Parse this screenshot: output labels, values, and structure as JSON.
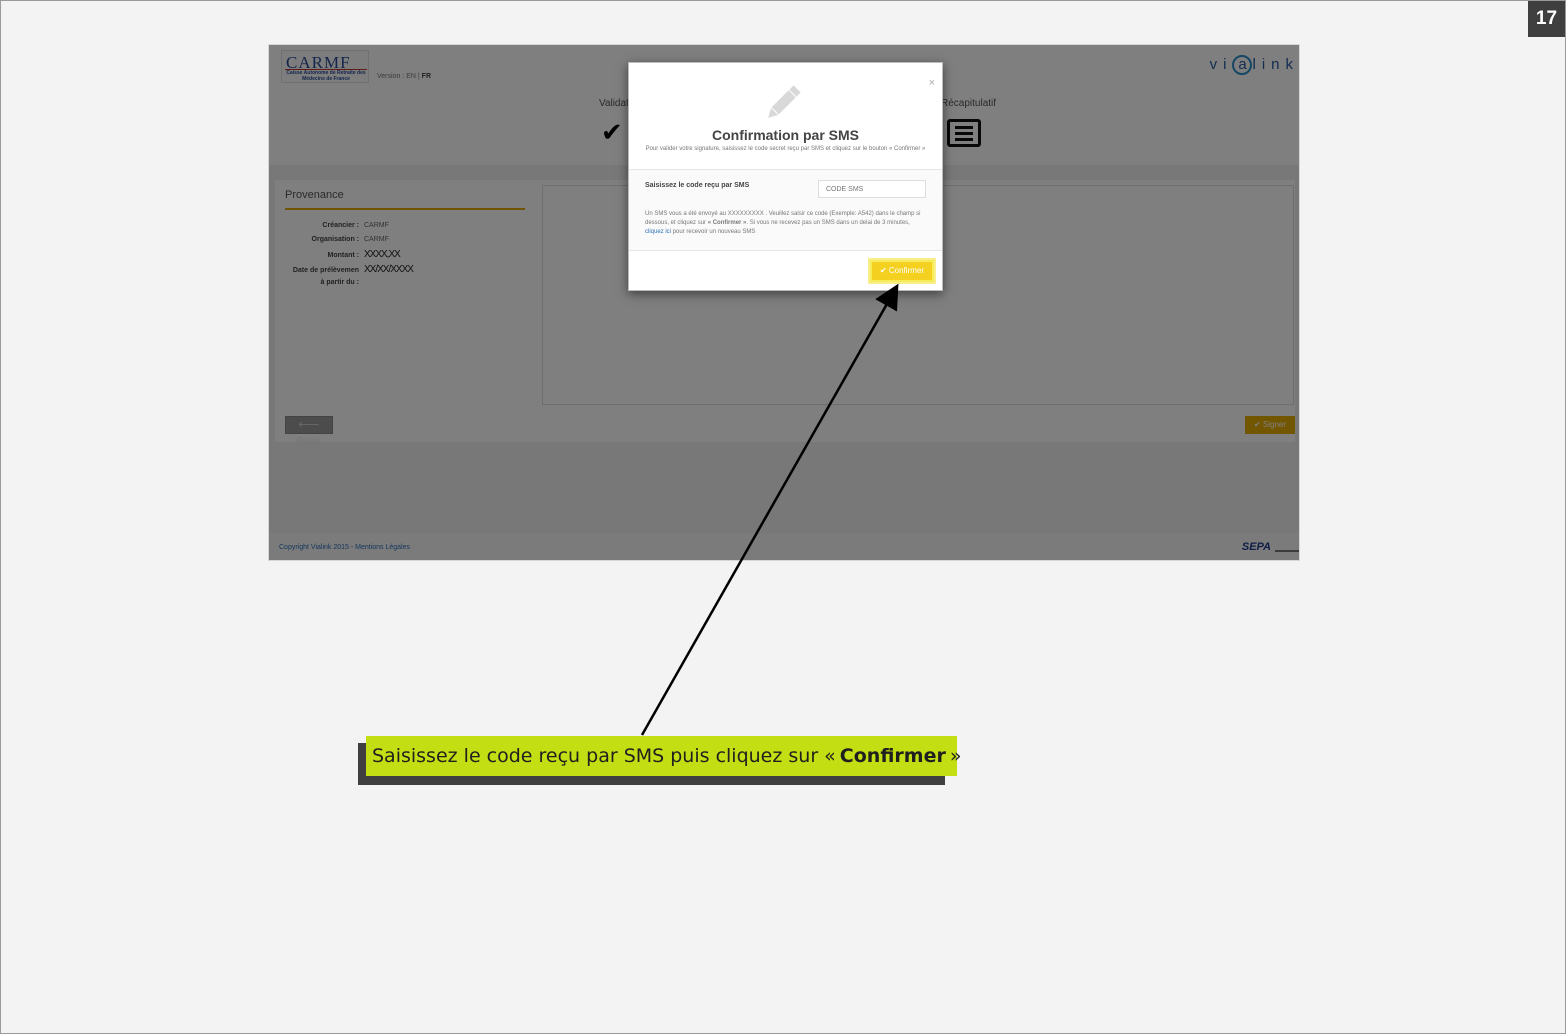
{
  "slide": {
    "page_number": "17"
  },
  "app": {
    "logo_text": "CARMF",
    "logo_subtext": "Caisse Autonome de Retraite des Médecins de France",
    "version_label": "Version :",
    "version_en": "EN",
    "version_sep": "|",
    "version_fr": "FR",
    "brand": "vialink",
    "brand_prefix": "vi",
    "brand_ring": "a",
    "brand_suffix": "link"
  },
  "steps": {
    "step1_label": "Validat",
    "step3_label": "Récapitulatif"
  },
  "provenance": {
    "title": "Provenance",
    "fields": [
      {
        "key": "Créancier :",
        "value": "CARMF"
      },
      {
        "key": "Organisation :",
        "value": "CARMF"
      },
      {
        "key": "Montant :",
        "value": "XXXX,XX"
      },
      {
        "key": "Date de prélèvemen",
        "value": "XX/XX/XXXX"
      },
      {
        "key": "à partir du :",
        "value": ""
      }
    ]
  },
  "buttons": {
    "retour": "Retour",
    "signer": "Signer",
    "confirmer": "Confirmer"
  },
  "icons": {
    "retour": "arrow-left-icon",
    "signer": "check-icon",
    "confirmer": "check-icon",
    "modal": "pencil-icon",
    "close": "close-icon",
    "step_done": "check-icon",
    "step_summary": "list-icon"
  },
  "footer": {
    "copyright": "Copyright Vialink 2015 - Mentions Légales",
    "sepa": "SEPA"
  },
  "modal": {
    "close": "×",
    "title": "Confirmation par SMS",
    "subtitle": "Pour valider votre signature, saisissez le code secret reçu par SMS et cliquez sur le bouton « Confirmer »",
    "code_label": "Saisissez le code reçu par SMS",
    "code_placeholder": "CODE SMS",
    "info_part1": "Un SMS vous a été envoyé au XXXXXXXXX . Veuillez saisir ce code (Exemple: A542) dans le champ si dessous, et cliquez sur",
    "info_bold": "« Confirmer »",
    "info_part2": ". Si vous ne recevez pas un SMS dans un delai de 3 minutes,",
    "info_link": "cliquez ici",
    "info_part3": "pour recevoir un nouveau SMS"
  },
  "callout": {
    "text_before": "Saisissez le code reçu par SMS puis cliquez sur «",
    "text_bold": "Confirmer",
    "text_after": "»"
  },
  "colors": {
    "callout_bg": "#c3de12",
    "accent_yellow": "#e5ad00",
    "confirm_yellow": "#f4d020",
    "link_blue": "#2a6fb8"
  }
}
